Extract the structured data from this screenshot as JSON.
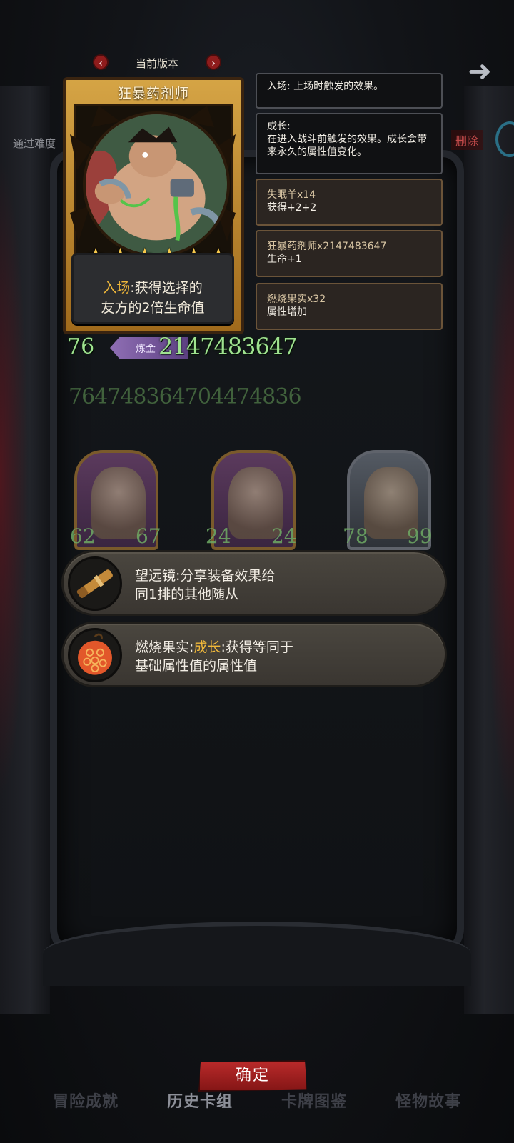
{
  "header": {
    "version_label": "当前版本",
    "prev_icon": "chevron-left-icon",
    "next_icon": "chevron-right-icon",
    "left_label": "通过难度",
    "right_label": "删除",
    "back_icon": "arrow-left-icon"
  },
  "card": {
    "name": "狂暴药剂师",
    "stars": "★",
    "star_count": 6,
    "desc_keyword": "入场",
    "desc_line1_rest": ":获得选择的",
    "desc_line2": "友方的2倍生命值",
    "attack": "76",
    "tag": "炼金",
    "health": "2147483647",
    "faded_row": "764748364704474836"
  },
  "tooltips": [
    {
      "line1": "入场: 上场时触发的效果。",
      "line2": "",
      "style": "dark"
    },
    {
      "line1": "成长:",
      "line2": "在进入战斗前触发的效果。成长会带来永久的属性值变化。",
      "style": "dark"
    },
    {
      "line1": "失眠羊x14",
      "line2": "获得+2+2",
      "style": "brown"
    },
    {
      "line1": "狂暴药剂师x2147483647",
      "line2": "生命+1",
      "style": "brown"
    },
    {
      "line1": "燃烧果实x32",
      "line2": "属性增加",
      "style": "brown"
    }
  ],
  "minions": [
    {
      "attack": "62",
      "health": "67"
    },
    {
      "attack": "24",
      "health": "24"
    },
    {
      "attack": "78",
      "health": "99"
    }
  ],
  "equipment": [
    {
      "icon": "telescope-icon",
      "name": "望远镜",
      "line1_rest": ":分享装备效果给",
      "line2": "同1排的其他随从",
      "keyword": ""
    },
    {
      "icon": "burning-fruit-icon",
      "name": "燃烧果实",
      "keyword": "成长",
      "line1_rest": ":获得等同于",
      "line2": "基础属性值的属性值"
    }
  ],
  "confirm_label": "确定",
  "tabs": [
    {
      "label": "冒险成就"
    },
    {
      "label": "历史卡组"
    },
    {
      "label": "卡牌图鉴"
    },
    {
      "label": "怪物故事"
    }
  ]
}
